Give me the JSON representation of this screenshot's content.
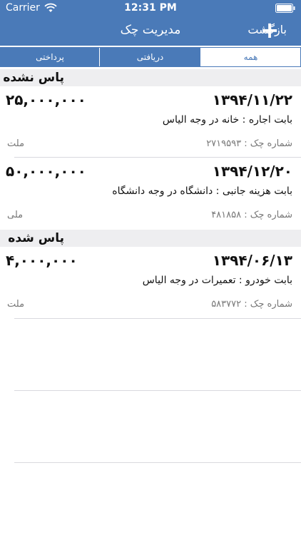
{
  "status_bar": {
    "carrier": "Carrier",
    "time": "12:31 PM"
  },
  "nav": {
    "add_label": "+",
    "title": "مدیریت چک",
    "back_label": "بازگشت"
  },
  "segments": {
    "all": "همه",
    "received": "دریافتی",
    "paid": "پرداختی",
    "selected": "همه"
  },
  "sections": [
    {
      "title": "پاس نشده",
      "items": [
        {
          "date": "۱۳۹۴/۱۱/۲۲",
          "amount": "۲۵,۰۰۰,۰۰۰",
          "description": "بابت اجاره : خانه در وجه الیاس",
          "check_number": "شماره چک : ۲۷۱۹۵۹۳",
          "bank": "ملت"
        },
        {
          "date": "۱۳۹۴/۱۲/۲۰",
          "amount": "۵۰,۰۰۰,۰۰۰",
          "description": "بابت هزینه جانبی : دانشگاه در وجه دانشگاه",
          "check_number": "شماره چک : ۴۸۱۸۵۸",
          "bank": "ملی"
        }
      ]
    },
    {
      "title": "پاس شده",
      "items": [
        {
          "date": "۱۳۹۴/۰۶/۱۳",
          "amount": "۴,۰۰۰,۰۰۰",
          "description": "بابت خودرو : تعمیرات در وجه الیاس",
          "check_number": "شماره چک : ۵۸۳۷۷۲",
          "bank": "ملت"
        }
      ]
    }
  ],
  "icons": {
    "wifi": "wifi-icon",
    "battery": "battery-icon",
    "add": "plus-icon"
  },
  "colors": {
    "accent": "#4a7ab8",
    "section_bg": "#eeeef0",
    "secondary_text": "#777777"
  }
}
